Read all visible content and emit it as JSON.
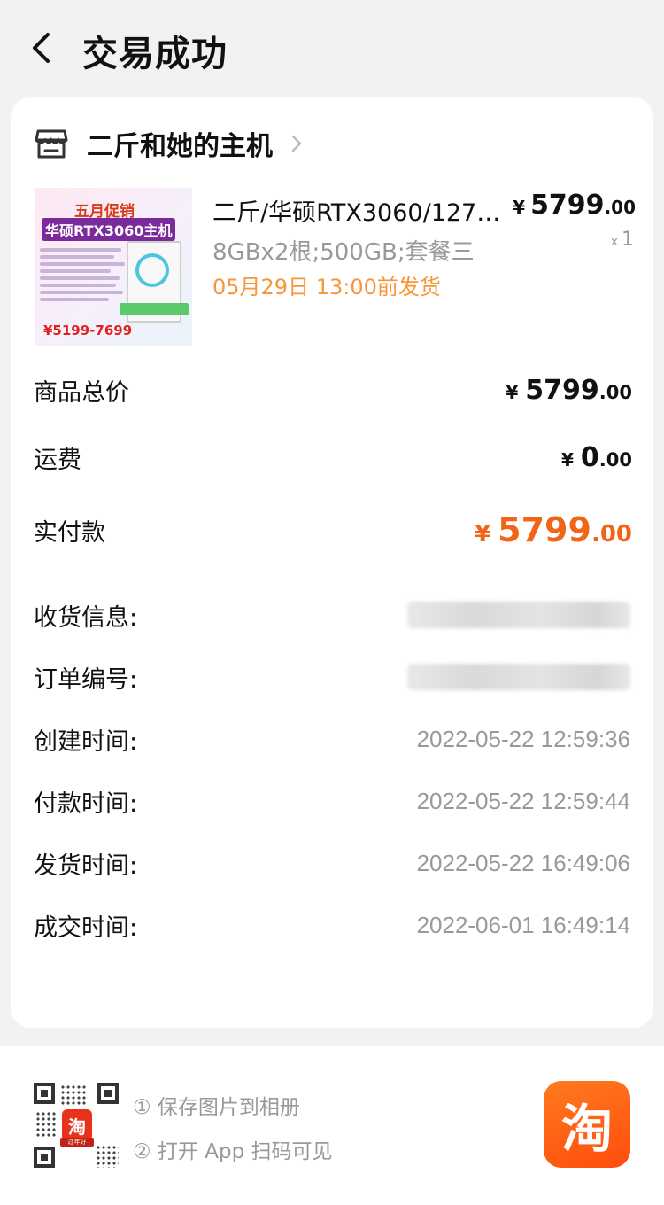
{
  "header": {
    "title": "交易成功"
  },
  "shop": {
    "name": "二斤和她的主机"
  },
  "product": {
    "title": "二斤/华硕RTX3060/127…",
    "spec": "8GBx2根;500GB;套餐三",
    "shipping": "05月29日 13:00前发货",
    "price_symbol": "¥",
    "price_int": "5799",
    "price_dec": ".00",
    "qty_prefix": "x",
    "qty": "1",
    "image": {
      "headline": "五月促销",
      "subheadline": "华硕RTX3060主机",
      "price_range": "¥5199-7699"
    }
  },
  "summary": {
    "goods_total_label": "商品总价",
    "goods_total_symbol": "¥",
    "goods_total_int": "5799",
    "goods_total_dec": ".00",
    "shipping_label": "运费",
    "shipping_symbol": "¥",
    "shipping_int": "0",
    "shipping_dec": ".00",
    "paid_label": "实付款",
    "paid_symbol": "¥",
    "paid_int": "5799",
    "paid_dec": ".00"
  },
  "info": {
    "receiver_label": "收货信息:",
    "order_no_label": "订单编号:",
    "created_label": "创建时间:",
    "created_value": "2022-05-22 12:59:36",
    "paid_label": "付款时间:",
    "paid_value": "2022-05-22 12:59:44",
    "shipped_label": "发货时间:",
    "shipped_value": "2022-05-22 16:49:06",
    "completed_label": "成交时间:",
    "completed_value": "2022-06-01 16:49:14"
  },
  "footer": {
    "step1": "① 保存图片到相册",
    "step2": "② 打开 App 扫码可见",
    "qr_logo_char": "淘",
    "qr_logo_tag": "过年好",
    "app_logo_char": "淘"
  },
  "colors": {
    "accent": "#f26418",
    "shipping_orange": "#f7963a",
    "muted": "#999999"
  },
  "icons": {
    "back": "chevron-left-icon",
    "shop": "store-icon",
    "shop_more": "chevron-right-icon",
    "app": "taobao-app-icon",
    "qr": "qr-code-icon"
  }
}
